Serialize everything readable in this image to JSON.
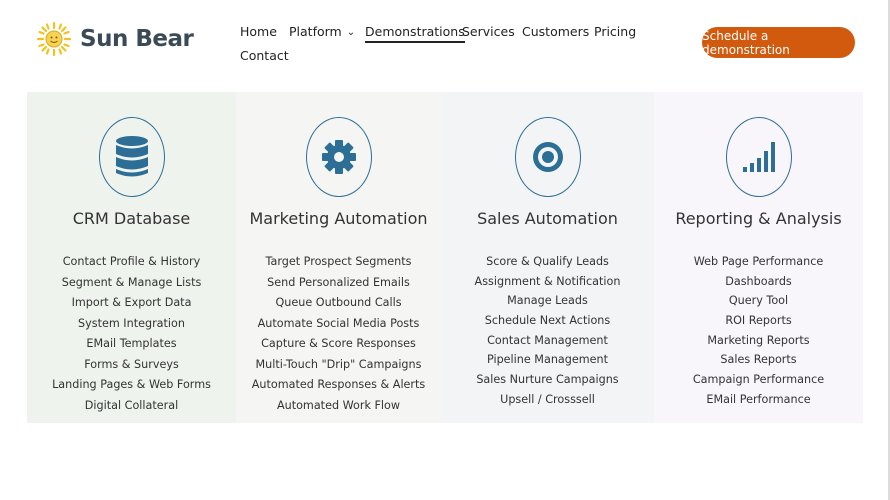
{
  "brand": {
    "name": "Sun Bear",
    "logo_icon": "sun-icon"
  },
  "nav": {
    "items": [
      {
        "label": "Home"
      },
      {
        "label": "Platform",
        "has_dropdown": true
      },
      {
        "label": "Demonstrations",
        "active": true
      },
      {
        "label": "Services"
      },
      {
        "label": "Customers"
      },
      {
        "label": "Pricing"
      },
      {
        "label": "Contact"
      }
    ],
    "dropdown_glyph": "⌄"
  },
  "cta": {
    "label": "Schedule a demonstration",
    "color": "#d25a0f"
  },
  "features": [
    {
      "title": "CRM Database",
      "icon": "database-icon",
      "items": [
        "Contact Profile & History",
        "Segment & Manage Lists",
        "Import & Export Data",
        "System Integration",
        "EMail Templates",
        "Forms & Surveys",
        "Landing Pages & Web Forms",
        "Digital Collateral"
      ]
    },
    {
      "title": "Marketing Automation",
      "icon": "gear-icon",
      "items": [
        "Target Prospect Segments",
        "Send Personalized Emails",
        "Queue Outbound Calls",
        "Automate Social Media Posts",
        "Capture & Score Responses",
        "Multi-Touch \"Drip\" Campaigns",
        "Automated Responses & Alerts",
        "Automated Work Flow"
      ]
    },
    {
      "title": "Sales Automation",
      "icon": "target-icon",
      "items": [
        "Score & Qualify Leads",
        "Assignment & Notification",
        "Manage Leads",
        "Schedule Next Actions",
        "Contact Management",
        "Pipeline Management",
        "Sales Nurture Campaigns",
        "Upsell / Crosssell"
      ]
    },
    {
      "title": "Reporting & Analysis",
      "icon": "signal-bars-icon",
      "items": [
        "Web Page Performance",
        "Dashboards",
        "Query Tool",
        "ROI Reports",
        "Marketing Reports",
        "Sales Reports",
        "Campaign Performance",
        "EMail Performance"
      ]
    }
  ],
  "colors": {
    "icon_blue": "#2c6e95",
    "brand_text": "#3b4a57",
    "sun_yellow": "#f2c21b"
  }
}
